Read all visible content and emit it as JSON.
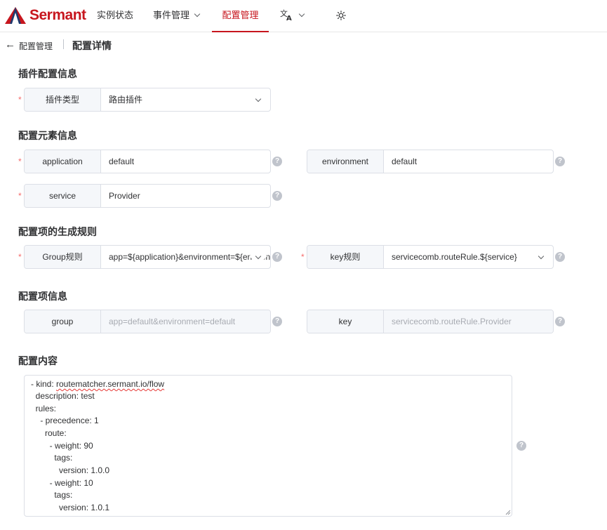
{
  "brand": {
    "name": "Sermant",
    "color": "#c7161e"
  },
  "nav": {
    "items": [
      {
        "label": "实例状态"
      },
      {
        "label": "事件管理"
      },
      {
        "label": "配置管理"
      }
    ],
    "lang_icon": "translate-icon",
    "theme_icon": "sun-icon"
  },
  "breadcrumb": {
    "parent": "配置管理",
    "title": "配置详情"
  },
  "sections": {
    "plugin": "插件配置信息",
    "element": "配置元素信息",
    "rule": "配置项的生成规则",
    "item": "配置项信息",
    "content": "配置内容"
  },
  "fields": {
    "plugin_type": {
      "label": "插件类型",
      "value": "路由插件"
    },
    "application": {
      "label": "application",
      "value": "default"
    },
    "environment": {
      "label": "environment",
      "value": "default"
    },
    "service": {
      "label": "service",
      "value": "Provider"
    },
    "group_rule": {
      "label": "Group规则",
      "value": "app=${application}&environment=${environment}"
    },
    "key_rule": {
      "label": "key规则",
      "value": "servicecomb.routeRule.${service}"
    },
    "group": {
      "label": "group",
      "value": "app=default&environment=default"
    },
    "key": {
      "label": "key",
      "value": "servicecomb.routeRule.Provider"
    }
  },
  "required_mark": "*",
  "help_glyph": "?",
  "content": {
    "kind_prefix": "- kind: ",
    "kind_value": "routematcher.sermant.io/flow",
    "lines": [
      "  description: test",
      "  rules:",
      "    - precedence: 1",
      "      route:",
      "        - weight: 90",
      "          tags:",
      "            version: 1.0.0",
      "        - weight: 10",
      "          tags:",
      "            version: 1.0.1"
    ]
  }
}
